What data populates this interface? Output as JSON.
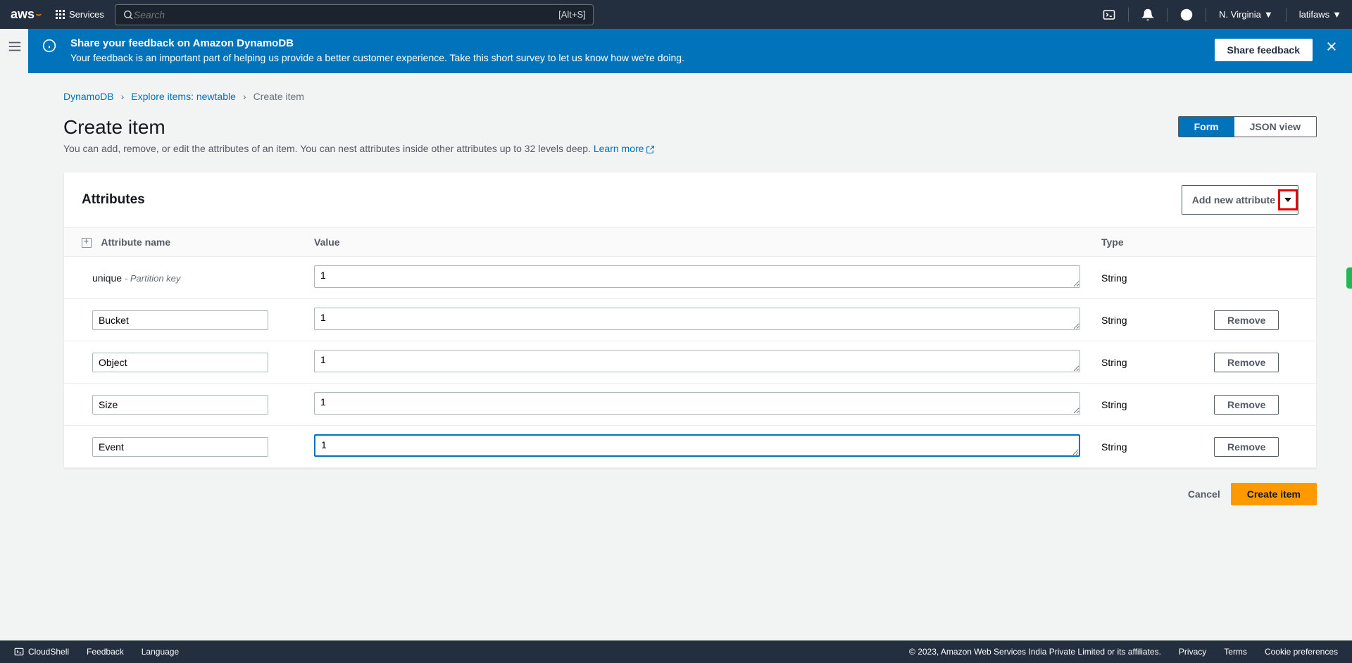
{
  "nav": {
    "logo": "aws",
    "services": "Services",
    "search_placeholder": "Search",
    "search_shortcut": "[Alt+S]",
    "region": "N. Virginia",
    "user": "latifaws"
  },
  "banner": {
    "title": "Share your feedback on Amazon DynamoDB",
    "text": "Your feedback is an important part of helping us provide a better customer experience. Take this short survey to let us know how we're doing.",
    "button": "Share feedback"
  },
  "breadcrumb": {
    "root": "DynamoDB",
    "mid": "Explore items: newtable",
    "leaf": "Create item"
  },
  "page": {
    "title": "Create item",
    "desc": "You can add, remove, or edit the attributes of an item. You can nest attributes inside other attributes up to 32 levels deep. ",
    "learn_more": "Learn more",
    "view_form": "Form",
    "view_json": "JSON view"
  },
  "card": {
    "title": "Attributes",
    "add_btn": "Add new attribute",
    "col_name": "Attribute name",
    "col_value": "Value",
    "col_type": "Type",
    "remove": "Remove"
  },
  "rows": [
    {
      "name": "unique",
      "meta": "Partition key",
      "value": "1",
      "type": "String",
      "editable_name": false,
      "removable": false,
      "active": false
    },
    {
      "name": "Bucket",
      "value": "1",
      "type": "String",
      "editable_name": true,
      "removable": true,
      "active": false
    },
    {
      "name": "Object",
      "value": "1",
      "type": "String",
      "editable_name": true,
      "removable": true,
      "active": false
    },
    {
      "name": "Size",
      "value": "1",
      "type": "String",
      "editable_name": true,
      "removable": true,
      "active": false
    },
    {
      "name": "Event",
      "value": "1",
      "type": "String",
      "editable_name": true,
      "removable": true,
      "active": true
    }
  ],
  "actions": {
    "cancel": "Cancel",
    "create": "Create item"
  },
  "footer": {
    "cloudshell": "CloudShell",
    "feedback": "Feedback",
    "language": "Language",
    "copyright": "© 2023, Amazon Web Services India Private Limited or its affiliates.",
    "privacy": "Privacy",
    "terms": "Terms",
    "cookies": "Cookie preferences"
  }
}
